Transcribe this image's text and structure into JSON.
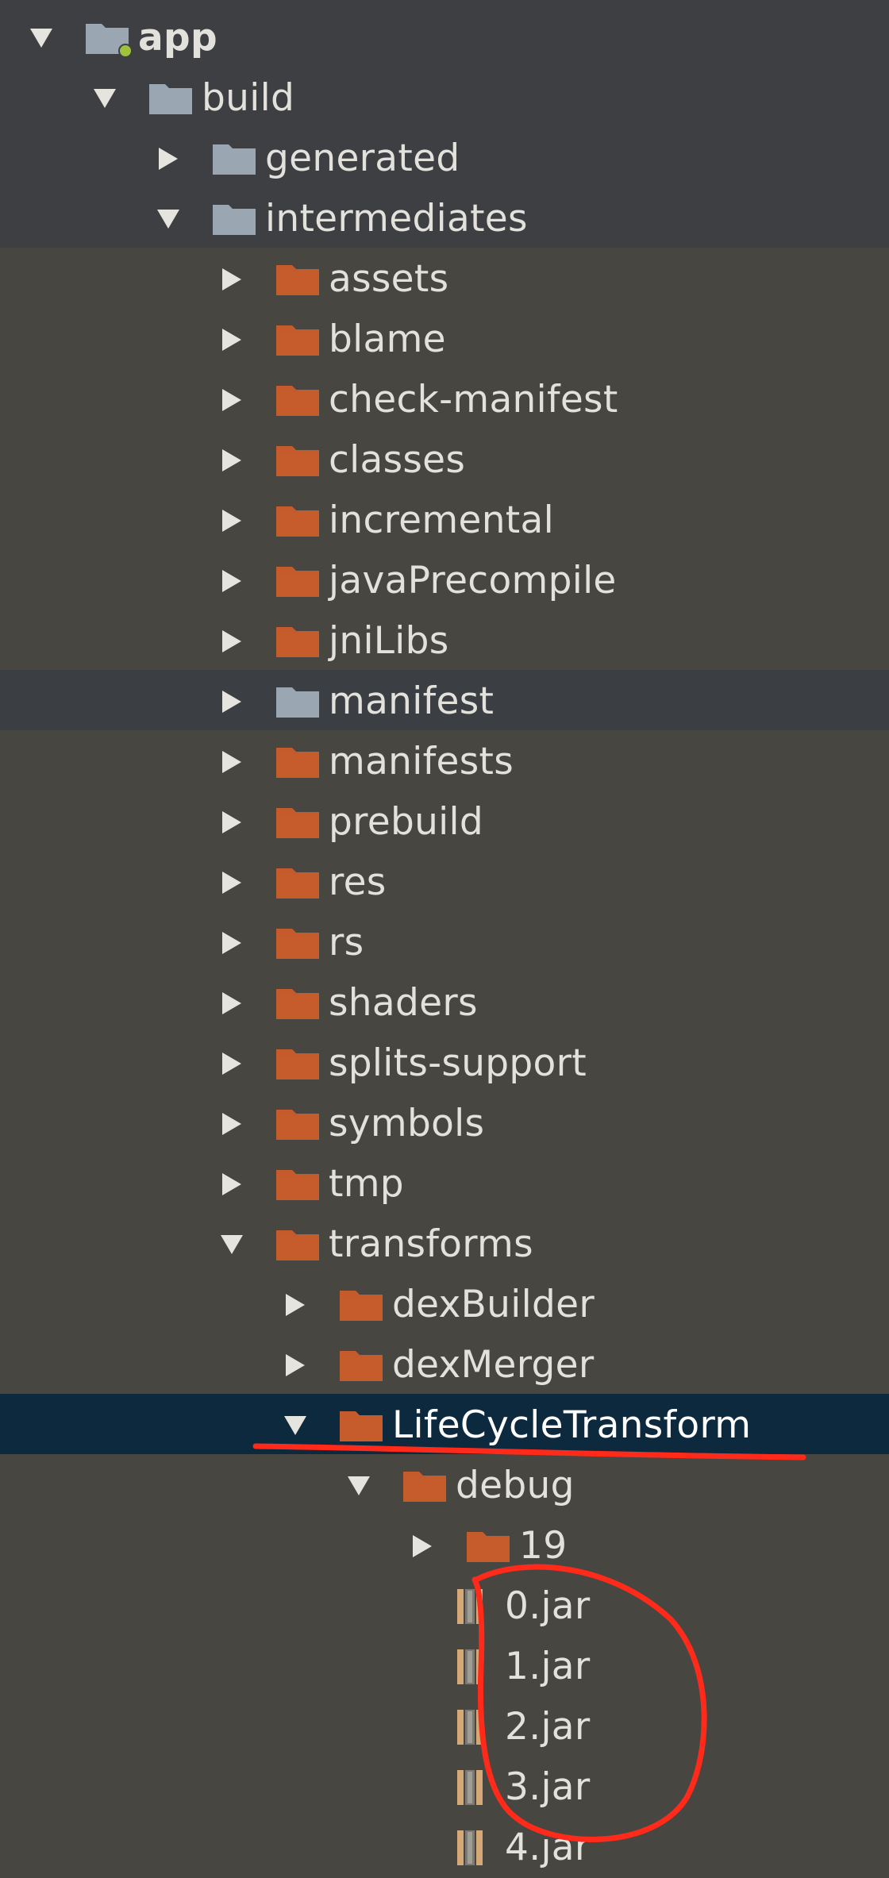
{
  "colors": {
    "background": "#484641",
    "header_band": "#3d3f43",
    "highlight_row": "#3b3e43",
    "selected_row": "#0d293e",
    "folder_orange": "#c55b2c",
    "folder_gray": "#9aa7b3",
    "jar_icon": "#d4a877",
    "annotation_red": "#ff2a1a",
    "text": "#e3e1dc"
  },
  "tree": [
    {
      "label": "app",
      "depth": 0,
      "arrow": "down",
      "icon": "module-folder-icon",
      "bold": true
    },
    {
      "label": "build",
      "depth": 1,
      "arrow": "down",
      "icon": "gray-folder-icon"
    },
    {
      "label": "generated",
      "depth": 2,
      "arrow": "right",
      "icon": "gray-folder-icon"
    },
    {
      "label": "intermediates",
      "depth": 2,
      "arrow": "down",
      "icon": "gray-folder-icon"
    },
    {
      "label": "assets",
      "depth": 3,
      "arrow": "right",
      "icon": "orange-folder-icon"
    },
    {
      "label": "blame",
      "depth": 3,
      "arrow": "right",
      "icon": "orange-folder-icon"
    },
    {
      "label": "check-manifest",
      "depth": 3,
      "arrow": "right",
      "icon": "orange-folder-icon"
    },
    {
      "label": "classes",
      "depth": 3,
      "arrow": "right",
      "icon": "orange-folder-icon"
    },
    {
      "label": "incremental",
      "depth": 3,
      "arrow": "right",
      "icon": "orange-folder-icon"
    },
    {
      "label": "javaPrecompile",
      "depth": 3,
      "arrow": "right",
      "icon": "orange-folder-icon"
    },
    {
      "label": "jniLibs",
      "depth": 3,
      "arrow": "right",
      "icon": "orange-folder-icon"
    },
    {
      "label": "manifest",
      "depth": 3,
      "arrow": "right",
      "icon": "gray-folder-icon",
      "highlight": true
    },
    {
      "label": "manifests",
      "depth": 3,
      "arrow": "right",
      "icon": "orange-folder-icon"
    },
    {
      "label": "prebuild",
      "depth": 3,
      "arrow": "right",
      "icon": "orange-folder-icon"
    },
    {
      "label": "res",
      "depth": 3,
      "arrow": "right",
      "icon": "orange-folder-icon"
    },
    {
      "label": "rs",
      "depth": 3,
      "arrow": "right",
      "icon": "orange-folder-icon"
    },
    {
      "label": "shaders",
      "depth": 3,
      "arrow": "right",
      "icon": "orange-folder-icon"
    },
    {
      "label": "splits-support",
      "depth": 3,
      "arrow": "right",
      "icon": "orange-folder-icon"
    },
    {
      "label": "symbols",
      "depth": 3,
      "arrow": "right",
      "icon": "orange-folder-icon"
    },
    {
      "label": "tmp",
      "depth": 3,
      "arrow": "right",
      "icon": "orange-folder-icon"
    },
    {
      "label": "transforms",
      "depth": 3,
      "arrow": "down",
      "icon": "orange-folder-icon"
    },
    {
      "label": "dexBuilder",
      "depth": 4,
      "arrow": "right",
      "icon": "orange-folder-icon"
    },
    {
      "label": "dexMerger",
      "depth": 4,
      "arrow": "right",
      "icon": "orange-folder-icon"
    },
    {
      "label": "LifeCycleTransform",
      "depth": 4,
      "arrow": "down",
      "icon": "orange-folder-icon",
      "selected": true
    },
    {
      "label": "debug",
      "depth": 5,
      "arrow": "down",
      "icon": "orange-folder-icon"
    },
    {
      "label": "19",
      "depth": 6,
      "arrow": "right",
      "icon": "orange-folder-icon"
    },
    {
      "label": "0.jar",
      "depth": 6,
      "arrow": "none",
      "icon": "jar-file-icon"
    },
    {
      "label": "1.jar",
      "depth": 6,
      "arrow": "none",
      "icon": "jar-file-icon"
    },
    {
      "label": "2.jar",
      "depth": 6,
      "arrow": "none",
      "icon": "jar-file-icon"
    },
    {
      "label": "3.jar",
      "depth": 6,
      "arrow": "none",
      "icon": "jar-file-icon"
    },
    {
      "label": "4.jar",
      "depth": 6,
      "arrow": "none",
      "icon": "jar-file-icon"
    }
  ]
}
